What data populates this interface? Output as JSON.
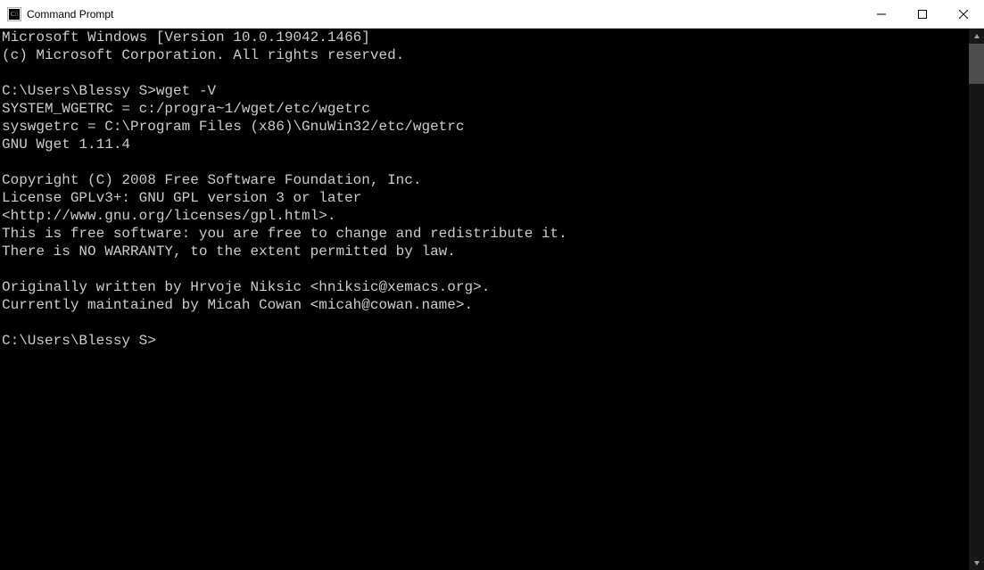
{
  "window": {
    "title": "Command Prompt"
  },
  "terminal": {
    "lines": [
      "Microsoft Windows [Version 10.0.19042.1466]",
      "(c) Microsoft Corporation. All rights reserved.",
      "",
      "C:\\Users\\Blessy S>wget -V",
      "SYSTEM_WGETRC = c:/progra~1/wget/etc/wgetrc",
      "syswgetrc = C:\\Program Files (x86)\\GnuWin32/etc/wgetrc",
      "GNU Wget 1.11.4",
      "",
      "Copyright (C) 2008 Free Software Foundation, Inc.",
      "License GPLv3+: GNU GPL version 3 or later",
      "<http://www.gnu.org/licenses/gpl.html>.",
      "This is free software: you are free to change and redistribute it.",
      "There is NO WARRANTY, to the extent permitted by law.",
      "",
      "Originally written by Hrvoje Niksic <hniksic@xemacs.org>.",
      "Currently maintained by Micah Cowan <micah@cowan.name>.",
      "",
      "C:\\Users\\Blessy S>"
    ]
  }
}
